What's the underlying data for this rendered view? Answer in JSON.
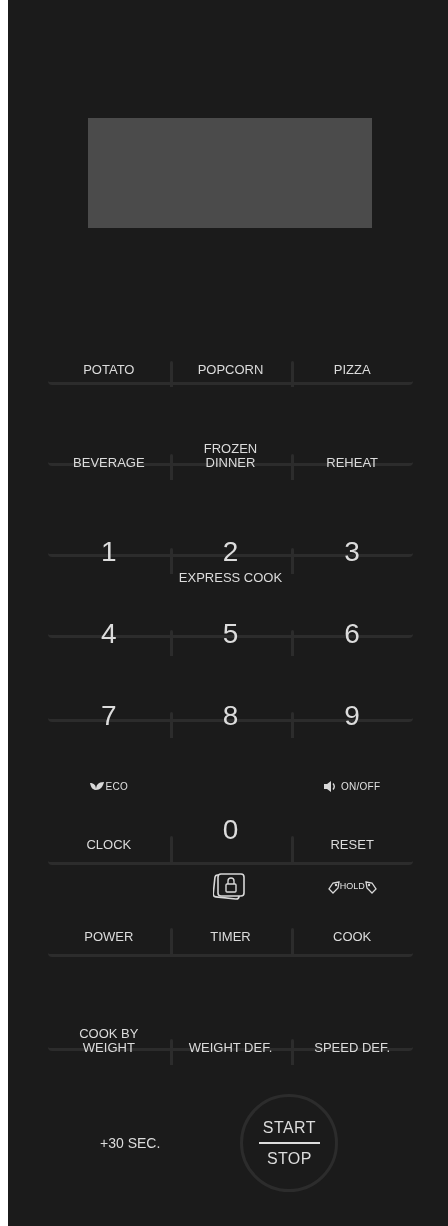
{
  "rows": [
    {
      "kind": "keys",
      "keys": [
        {
          "kind": "text",
          "label": "POTATO"
        },
        {
          "kind": "text",
          "label": "POPCORN"
        },
        {
          "kind": "text",
          "label": "PIZZA"
        }
      ]
    },
    {
      "kind": "keys",
      "keys": [
        {
          "kind": "text",
          "label": "BEVERAGE"
        },
        {
          "kind": "text",
          "label": "FROZEN\nDINNER"
        },
        {
          "kind": "text",
          "label": "REHEAT"
        }
      ]
    },
    {
      "kind": "keys",
      "keys": [
        {
          "kind": "digit",
          "label": "1"
        },
        {
          "kind": "digit",
          "label": "2"
        },
        {
          "kind": "digit",
          "label": "3"
        }
      ]
    },
    {
      "kind": "caption",
      "label": "EXPRESS COOK"
    },
    {
      "kind": "keys",
      "keys": [
        {
          "kind": "digit",
          "label": "4"
        },
        {
          "kind": "digit",
          "label": "5"
        },
        {
          "kind": "digit",
          "label": "6"
        }
      ]
    },
    {
      "kind": "keys",
      "keys": [
        {
          "kind": "digit",
          "label": "7"
        },
        {
          "kind": "digit",
          "label": "8"
        },
        {
          "kind": "digit",
          "label": "9"
        }
      ]
    },
    {
      "kind": "keys",
      "keys": [
        {
          "kind": "text",
          "label": "CLOCK",
          "caption": {
            "kind": "eco",
            "text": "ECO"
          }
        },
        {
          "kind": "digit",
          "label": "0"
        },
        {
          "kind": "text",
          "label": "RESET",
          "caption": {
            "kind": "sound",
            "text": "ON/OFF"
          }
        }
      ]
    },
    {
      "kind": "keys",
      "keys": [
        {
          "kind": "text",
          "label": "POWER"
        },
        {
          "kind": "text",
          "label": "TIMER",
          "caption": {
            "kind": "lock"
          }
        },
        {
          "kind": "text",
          "label": "COOK",
          "caption": {
            "kind": "hold",
            "text": "HOLD"
          }
        }
      ]
    },
    {
      "kind": "keys",
      "keys": [
        {
          "kind": "text",
          "label": "COOK BY\nWEIGHT"
        },
        {
          "kind": "text",
          "label": "WEIGHT DEF."
        },
        {
          "kind": "text",
          "label": "SPEED DEF."
        }
      ]
    }
  ],
  "quick_add": "+30 SEC.",
  "start_stop": {
    "top": "START",
    "bottom": "STOP"
  }
}
